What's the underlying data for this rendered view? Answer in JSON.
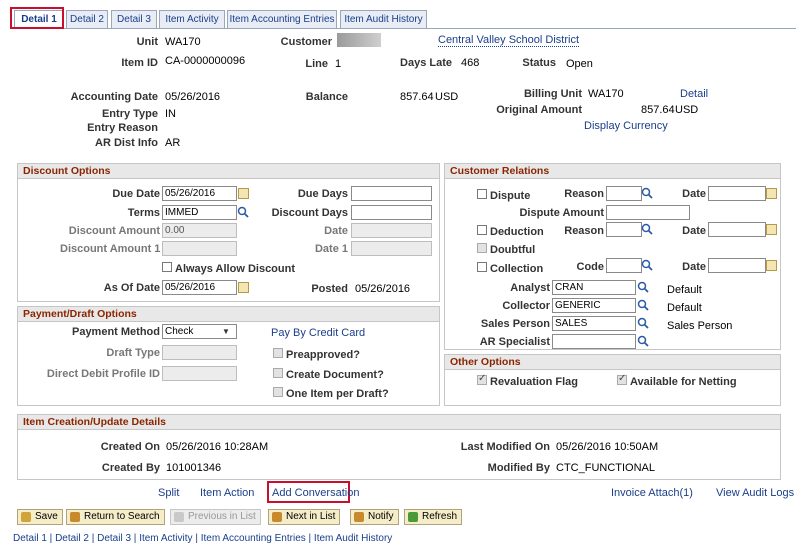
{
  "tabs": [
    "Detail 1",
    "Detail 2",
    "Detail 3",
    "Item Activity",
    "Item Accounting Entries",
    "Item Audit History"
  ],
  "header": {
    "unit_label": "Unit",
    "unit_value": "WA170",
    "customer_label": "Customer",
    "customer_name": "Central Valley School District",
    "item_id_label": "Item ID",
    "item_id_value": "CA-0000000096",
    "line_label": "Line",
    "line_value": "1",
    "days_late_label": "Days Late",
    "days_late_value": "468",
    "status_label": "Status",
    "status_value": "Open"
  },
  "info": {
    "accounting_date_label": "Accounting Date",
    "accounting_date_value": "05/26/2016",
    "balance_label": "Balance",
    "balance_value": "857.64",
    "balance_currency": "USD",
    "billing_unit_label": "Billing Unit",
    "billing_unit_value": "WA170",
    "detail_link": "Detail",
    "entry_type_label": "Entry Type",
    "entry_type_value": "IN",
    "original_amount_label": "Original Amount",
    "original_amount_value": "857.64",
    "original_amount_currency": "USD",
    "entry_reason_label": "Entry Reason",
    "display_currency_link": "Display Currency",
    "ar_dist_label": "AR Dist Info",
    "ar_dist_value": "AR"
  },
  "discount": {
    "title": "Discount Options",
    "due_date_label": "Due Date",
    "due_date_value": "05/26/2016",
    "due_days_label": "Due Days",
    "terms_label": "Terms",
    "terms_value": "IMMED",
    "discount_days_label": "Discount Days",
    "discount_amount_label": "Discount Amount",
    "discount_amount_value": "0.00",
    "date_label": "Date",
    "discount_amount1_label": "Discount Amount 1",
    "date1_label": "Date 1",
    "always_allow_label": "Always Allow Discount",
    "as_of_date_label": "As Of Date",
    "as_of_date_value": "05/26/2016",
    "posted_label": "Posted",
    "posted_value": "05/26/2016"
  },
  "payment": {
    "title": "Payment/Draft Options",
    "method_label": "Payment Method",
    "method_value": "Check",
    "pay_by_cc_link": "Pay By Credit Card",
    "draft_type_label": "Draft Type",
    "preapproved_label": "Preapproved?",
    "direct_debit_label": "Direct Debit Profile ID",
    "create_doc_label": "Create Document?",
    "one_item_label": "One Item per Draft?"
  },
  "customer_relations": {
    "title": "Customer Relations",
    "dispute_label": "Dispute",
    "reason_label": "Reason",
    "date_label": "Date",
    "dispute_amount_label": "Dispute Amount",
    "deduction_label": "Deduction",
    "doubtful_label": "Doubtful",
    "collection_label": "Collection",
    "code_label": "Code",
    "analyst_label": "Analyst",
    "analyst_value": "CRAN",
    "analyst_default": "Default",
    "collector_label": "Collector",
    "collector_value": "GENERIC",
    "collector_default": "Default",
    "sales_person_label": "Sales Person",
    "sales_person_value": "SALES",
    "sales_person_desc": "Sales Person",
    "ar_specialist_label": "AR Specialist"
  },
  "other_options": {
    "title": "Other Options",
    "revaluation_label": "Revaluation Flag",
    "netting_label": "Available for Netting"
  },
  "creation": {
    "title": "Item Creation/Update Details",
    "created_on_label": "Created On",
    "created_on_value": "05/26/2016 10:28AM",
    "last_modified_label": "Last Modified On",
    "last_modified_value": "05/26/2016 10:50AM",
    "created_by_label": "Created By",
    "created_by_value": "101001346",
    "modified_by_label": "Modified By",
    "modified_by_value": "CTC_FUNCTIONAL"
  },
  "action_links": {
    "split": "Split",
    "item_action": "Item Action",
    "add_conversation": "Add Conversation",
    "invoice_attach": "Invoice Attach(1)",
    "view_audit_logs": "View Audit Logs"
  },
  "toolbar": {
    "save": "Save",
    "return_to_search": "Return to Search",
    "previous_in_list": "Previous in List",
    "next_in_list": "Next in List",
    "notify": "Notify",
    "refresh": "Refresh"
  },
  "footer_links": [
    "Detail 1",
    "Detail 2",
    "Detail 3",
    "Item Activity",
    "Item Accounting Entries",
    "Item Audit History"
  ],
  "footer_separator": " | ",
  "colors": {
    "section_title": "#8b2500",
    "link": "#1a3e8a",
    "highlight": "#c8102e"
  }
}
